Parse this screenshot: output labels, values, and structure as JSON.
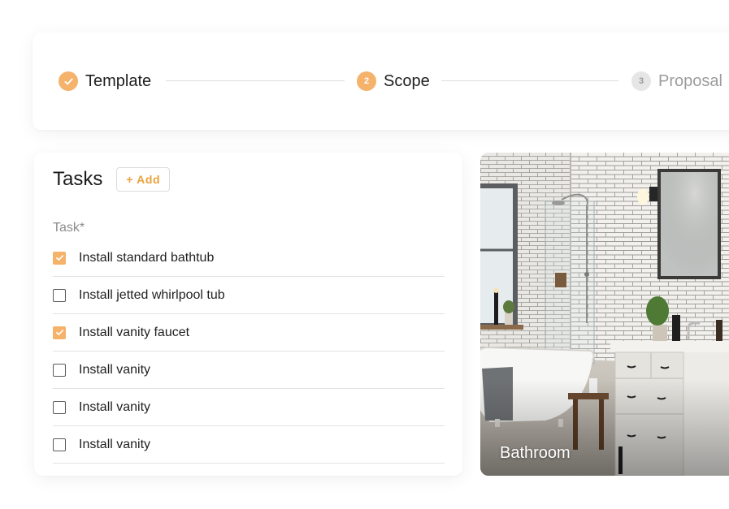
{
  "stepper": {
    "steps": [
      {
        "label": "Template",
        "state": "done",
        "number": "1"
      },
      {
        "label": "Scope",
        "state": "active",
        "number": "2"
      },
      {
        "label": "Proposal",
        "state": "todo",
        "number": "3"
      }
    ]
  },
  "tasks": {
    "title": "Tasks",
    "add_label": "+ Add",
    "column_label": "Task*",
    "items": [
      {
        "label": "Install standard bathtub",
        "checked": true
      },
      {
        "label": "Install jetted whirlpool tub",
        "checked": false
      },
      {
        "label": "Install vanity faucet",
        "checked": true
      },
      {
        "label": "Install vanity",
        "checked": false
      },
      {
        "label": "Install vanity",
        "checked": false
      },
      {
        "label": "Install vanity",
        "checked": false
      }
    ]
  },
  "photo": {
    "caption": "Bathroom"
  },
  "colors": {
    "accent": "#f5b26b",
    "add_text": "#e9a23b",
    "muted": "#9c9c9c"
  }
}
